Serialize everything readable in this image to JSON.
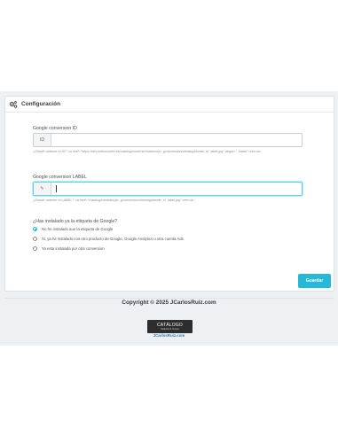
{
  "panel": {
    "title": "Configuración",
    "icon": "gears-icon"
  },
  "conversion_id": {
    "label": "Google conversion ID",
    "addon": "ID",
    "value": "",
    "help": "¿Donde obtener el ID? <a href=\"https://dev.webscrutter.es/catalog/content/modules/jcr_gconversion/viewing/donde_el_label.jpg\" target=\"_blank\">ver</a>"
  },
  "conversion_label": {
    "label": "Google conversion LABEL",
    "addon": "✎",
    "value": "",
    "help": "¿Donde obtener el LABEL? <a href=\"/catalog/modules/jcr_gconversion/viewing/donde_el_label.jpg\">ver</a>"
  },
  "tag_question": {
    "label": "¿Has instalado ya la etiqueta de Google?",
    "options": [
      {
        "label": "No he instalado aun la etiqueta de Google",
        "checked": true
      },
      {
        "label": "Si, ya he instalado con otro producto de Google, Google Analytics u otra cuenta Ads",
        "checked": false
      },
      {
        "label": "Ya esta instalada por otra conversion",
        "checked": false
      }
    ]
  },
  "save_button": "Guardar",
  "footer": {
    "copyright": "Copyright © 2025 JCarlosRuiz.com",
    "logo_line1": "CATÁLOGO",
    "logo_line2": "Módulos & Temas",
    "site": "JCarlosRuiz.com"
  },
  "colors": {
    "accent": "#25b9d7",
    "link": "#2a7fc0"
  }
}
